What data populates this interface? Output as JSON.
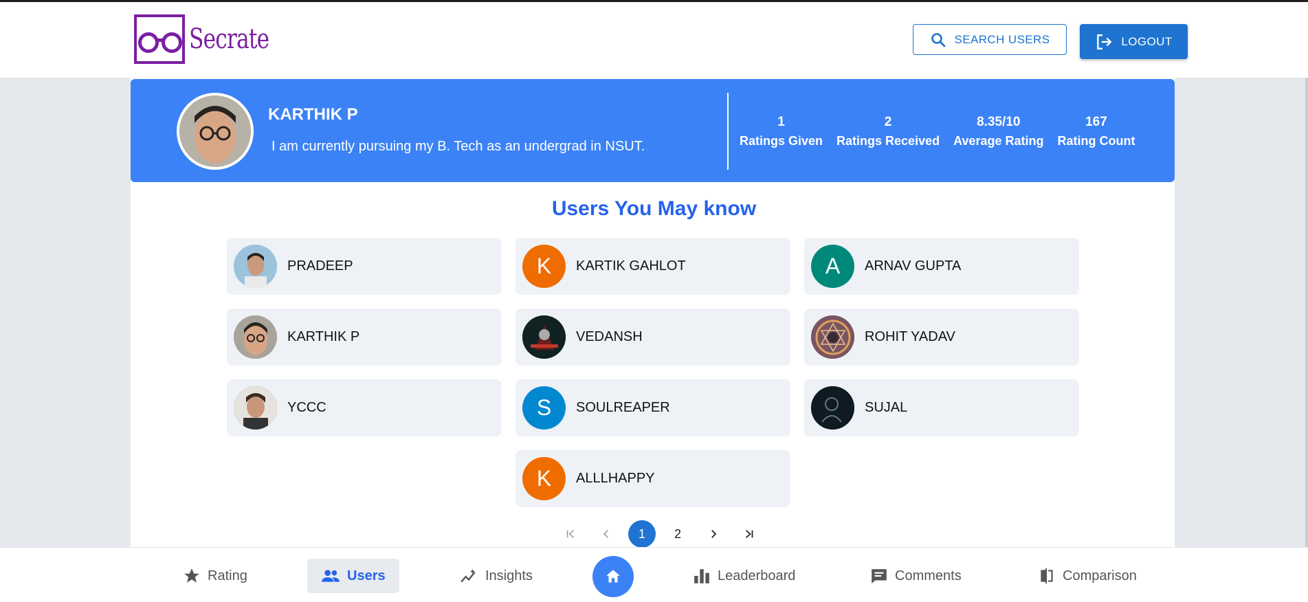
{
  "app": {
    "name": "Secrate"
  },
  "header": {
    "search_label": "SEARCH USERS",
    "logout_label": "LOGOUT"
  },
  "profile": {
    "name": "KARTHIK P",
    "bio": "I am currently pursuing my B. Tech as an undergrad in NSUT.",
    "stats": [
      {
        "value": "1",
        "label": "Ratings Given"
      },
      {
        "value": "2",
        "label": "Ratings Received"
      },
      {
        "value": "8.35/10",
        "label": "Average Rating"
      },
      {
        "value": "167",
        "label": "Rating Count"
      }
    ]
  },
  "section": {
    "title": "Users You May know"
  },
  "users": [
    {
      "name": "PRADEEP",
      "initial": "",
      "avatar": "photo-icon",
      "color": "#8fb3cc"
    },
    {
      "name": "KARTIK GAHLOT",
      "initial": "K",
      "avatar": "letter",
      "color": "#ef6c00"
    },
    {
      "name": "ARNAV GUPTA",
      "initial": "A",
      "avatar": "letter",
      "color": "#00897b"
    },
    {
      "name": "KARTHIK P",
      "initial": "",
      "avatar": "photo-icon",
      "color": "#c89d7f"
    },
    {
      "name": "VEDANSH",
      "initial": "",
      "avatar": "photo-icon",
      "color": "#1a2a2a"
    },
    {
      "name": "ROHIT YADAV",
      "initial": "",
      "avatar": "photo-icon",
      "color": "#6b4a5a"
    },
    {
      "name": "YCCC",
      "initial": "",
      "avatar": "photo-icon",
      "color": "#5c4a3c"
    },
    {
      "name": "SOULREAPER",
      "initial": "S",
      "avatar": "letter",
      "color": "#0288d1"
    },
    {
      "name": "SUJAL",
      "initial": "",
      "avatar": "photo-icon",
      "color": "#0f1a22"
    },
    {
      "name": "ALLLHAPPY",
      "initial": "K",
      "avatar": "letter",
      "color": "#ef6c00"
    }
  ],
  "pagination": {
    "pages": [
      "1",
      "2"
    ],
    "current": "1"
  },
  "bottom_nav": [
    {
      "label": "Rating",
      "icon": "star-icon"
    },
    {
      "label": "Users",
      "icon": "people-icon",
      "active": true
    },
    {
      "label": "Insights",
      "icon": "insights-icon"
    },
    {
      "label": "Leaderboard",
      "icon": "bar-chart-icon"
    },
    {
      "label": "Comments",
      "icon": "comment-icon"
    },
    {
      "label": "Comparison",
      "icon": "compare-icon"
    }
  ],
  "colors": {
    "primary": "#1e74d0",
    "profile_bg": "#3b82f6",
    "brand": "#7b1fa2",
    "title": "#2563eb"
  }
}
